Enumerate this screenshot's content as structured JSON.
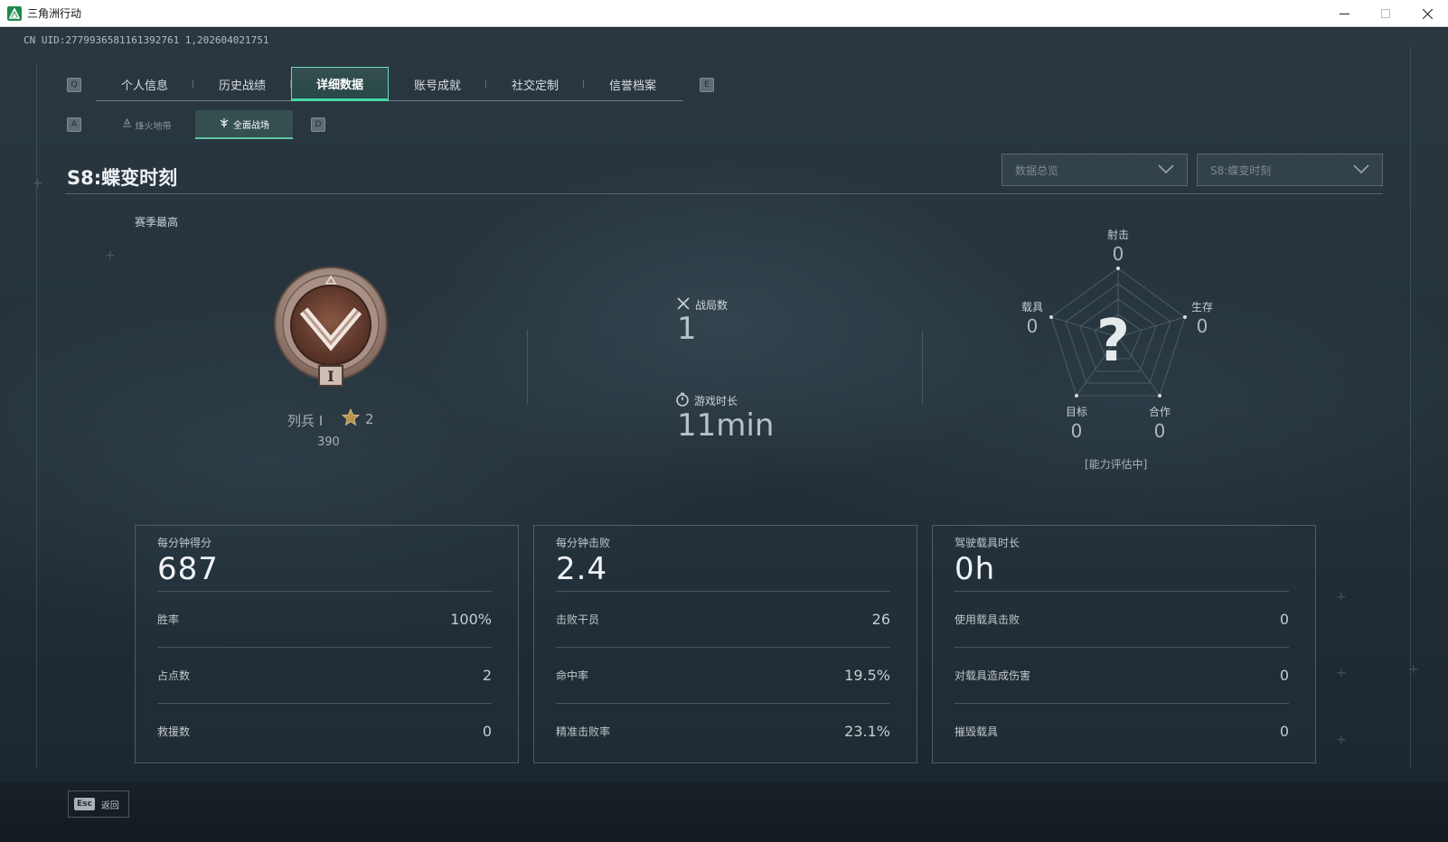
{
  "window": {
    "title": "三角洲行动",
    "minimize_icon": "minimize-icon",
    "maximize_icon": "maximize-icon",
    "close_icon": "close-icon"
  },
  "uid": "CN UID:2779936581161392761 1,202604021751",
  "nav": {
    "prev_key": "Q",
    "next_key": "E",
    "tabs": [
      {
        "label": "个人信息"
      },
      {
        "label": "历史战绩"
      },
      {
        "label": "详细数据",
        "active": true
      },
      {
        "label": "账号成就"
      },
      {
        "label": "社交定制"
      },
      {
        "label": "信誉档案"
      }
    ]
  },
  "mode_nav": {
    "prev_key": "A",
    "next_key": "D",
    "tabs": [
      {
        "label": "烽火地带",
        "icon": "beacon-icon"
      },
      {
        "label": "全面战场",
        "icon": "battlefield-icon",
        "active": true
      }
    ]
  },
  "season": {
    "title": "S8:蝶变时刻",
    "filter_type": "数据总览",
    "filter_season": "S8:蝶变时刻"
  },
  "rank": {
    "section_label": "赛季最高",
    "name": "列兵 I",
    "stars": "2",
    "score": "390",
    "badge_icon": "private-rank-badge-icon"
  },
  "summary": {
    "matches_label": "战局数",
    "matches_value": "1",
    "time_label": "游戏时长",
    "time_value": "11min"
  },
  "radar": {
    "center_mark": "?",
    "status": "[能力评估中]",
    "axes": [
      {
        "label": "射击",
        "value": "0"
      },
      {
        "label": "生存",
        "value": "0"
      },
      {
        "label": "合作",
        "value": "0"
      },
      {
        "label": "目标",
        "value": "0"
      },
      {
        "label": "载具",
        "value": "0"
      }
    ]
  },
  "cards": [
    {
      "title": "每分钟得分",
      "value": "687",
      "rows": [
        {
          "label": "胜率",
          "value": "100%"
        },
        {
          "label": "占点数",
          "value": "2"
        },
        {
          "label": "救援数",
          "value": "0"
        }
      ]
    },
    {
      "title": "每分钟击败",
      "value": "2.4",
      "rows": [
        {
          "label": "击败干员",
          "value": "26"
        },
        {
          "label": "命中率",
          "value": "19.5%"
        },
        {
          "label": "精准击败率",
          "value": "23.1%"
        }
      ]
    },
    {
      "title": "驾驶载具时长",
      "value": "0h",
      "rows": [
        {
          "label": "使用载具击败",
          "value": "0"
        },
        {
          "label": "对载具造成伤害",
          "value": "0"
        },
        {
          "label": "摧毁载具",
          "value": "0"
        }
      ]
    }
  ],
  "footer": {
    "esc_key": "Esc",
    "back_label": "返回"
  },
  "colors": {
    "accent": "#45d6a3",
    "background": "#25323c",
    "rank_bronze": "#9a6a55"
  }
}
